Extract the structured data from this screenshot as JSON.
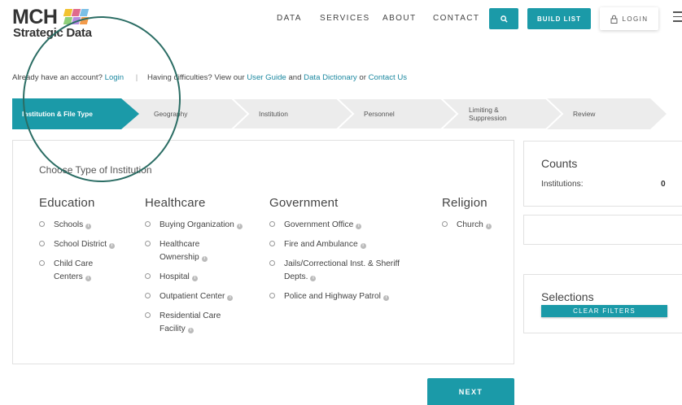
{
  "header": {
    "logo_main": "MCH",
    "logo_sub": "Strategic Data",
    "nav": [
      "DATA",
      "SERVICES",
      "ABOUT",
      "CONTACT"
    ],
    "build_list": "BUILD LIST",
    "login": "LOGIN",
    "search_icon": "search-icon",
    "lock_icon": "lock-icon",
    "menu_icon": "hamburger-icon"
  },
  "account": {
    "have_account": "Already have an account?",
    "login_link": "Login",
    "sep": "|",
    "difficulties": "Having difficulties? View our",
    "user_guide": "User Guide",
    "and": "and",
    "data_dictionary": "Data Dictionary",
    "or": "or",
    "contact_us": "Contact Us"
  },
  "steps": [
    {
      "label": "Institution & File Type",
      "active": true
    },
    {
      "label": "Geography",
      "active": false
    },
    {
      "label": "Institution",
      "active": false
    },
    {
      "label": "Personnel",
      "active": false
    },
    {
      "label": "Limiting & Suppression",
      "active": false
    },
    {
      "label": "Review",
      "active": false
    }
  ],
  "main": {
    "choose_title": "Choose Type of Institution",
    "columns": [
      {
        "title": "Education",
        "options": [
          "Schools",
          "School District",
          "Child Care Centers"
        ]
      },
      {
        "title": "Healthcare",
        "options": [
          "Buying Organization",
          "Healthcare Ownership",
          "Hospital",
          "Outpatient Center",
          "Residential Care Facility"
        ]
      },
      {
        "title": "Government",
        "options": [
          "Government Office",
          "Fire and Ambulance",
          "Jails/Correctional Inst. & Sheriff Depts.",
          "Police and Highway Patrol"
        ]
      },
      {
        "title": "Religion",
        "options": [
          "Church"
        ]
      }
    ],
    "info_glyph": "i"
  },
  "counts": {
    "title": "Counts",
    "institutions_label": "Institutions:",
    "institutions_value": "0"
  },
  "selections": {
    "title": "Selections",
    "clear_filters": "CLEAR FILTERS"
  },
  "next_button": "NEXT",
  "colors": {
    "teal": "#1b9aa8",
    "step_inactive": "#ececec",
    "link": "#1b88a0",
    "annotation": "#2b6d64",
    "logo_blocks": [
      "#f2c230",
      "#e06a8c",
      "#7cc0e6",
      "#8fd07a",
      "#b48be0",
      "#f39b4b"
    ]
  }
}
